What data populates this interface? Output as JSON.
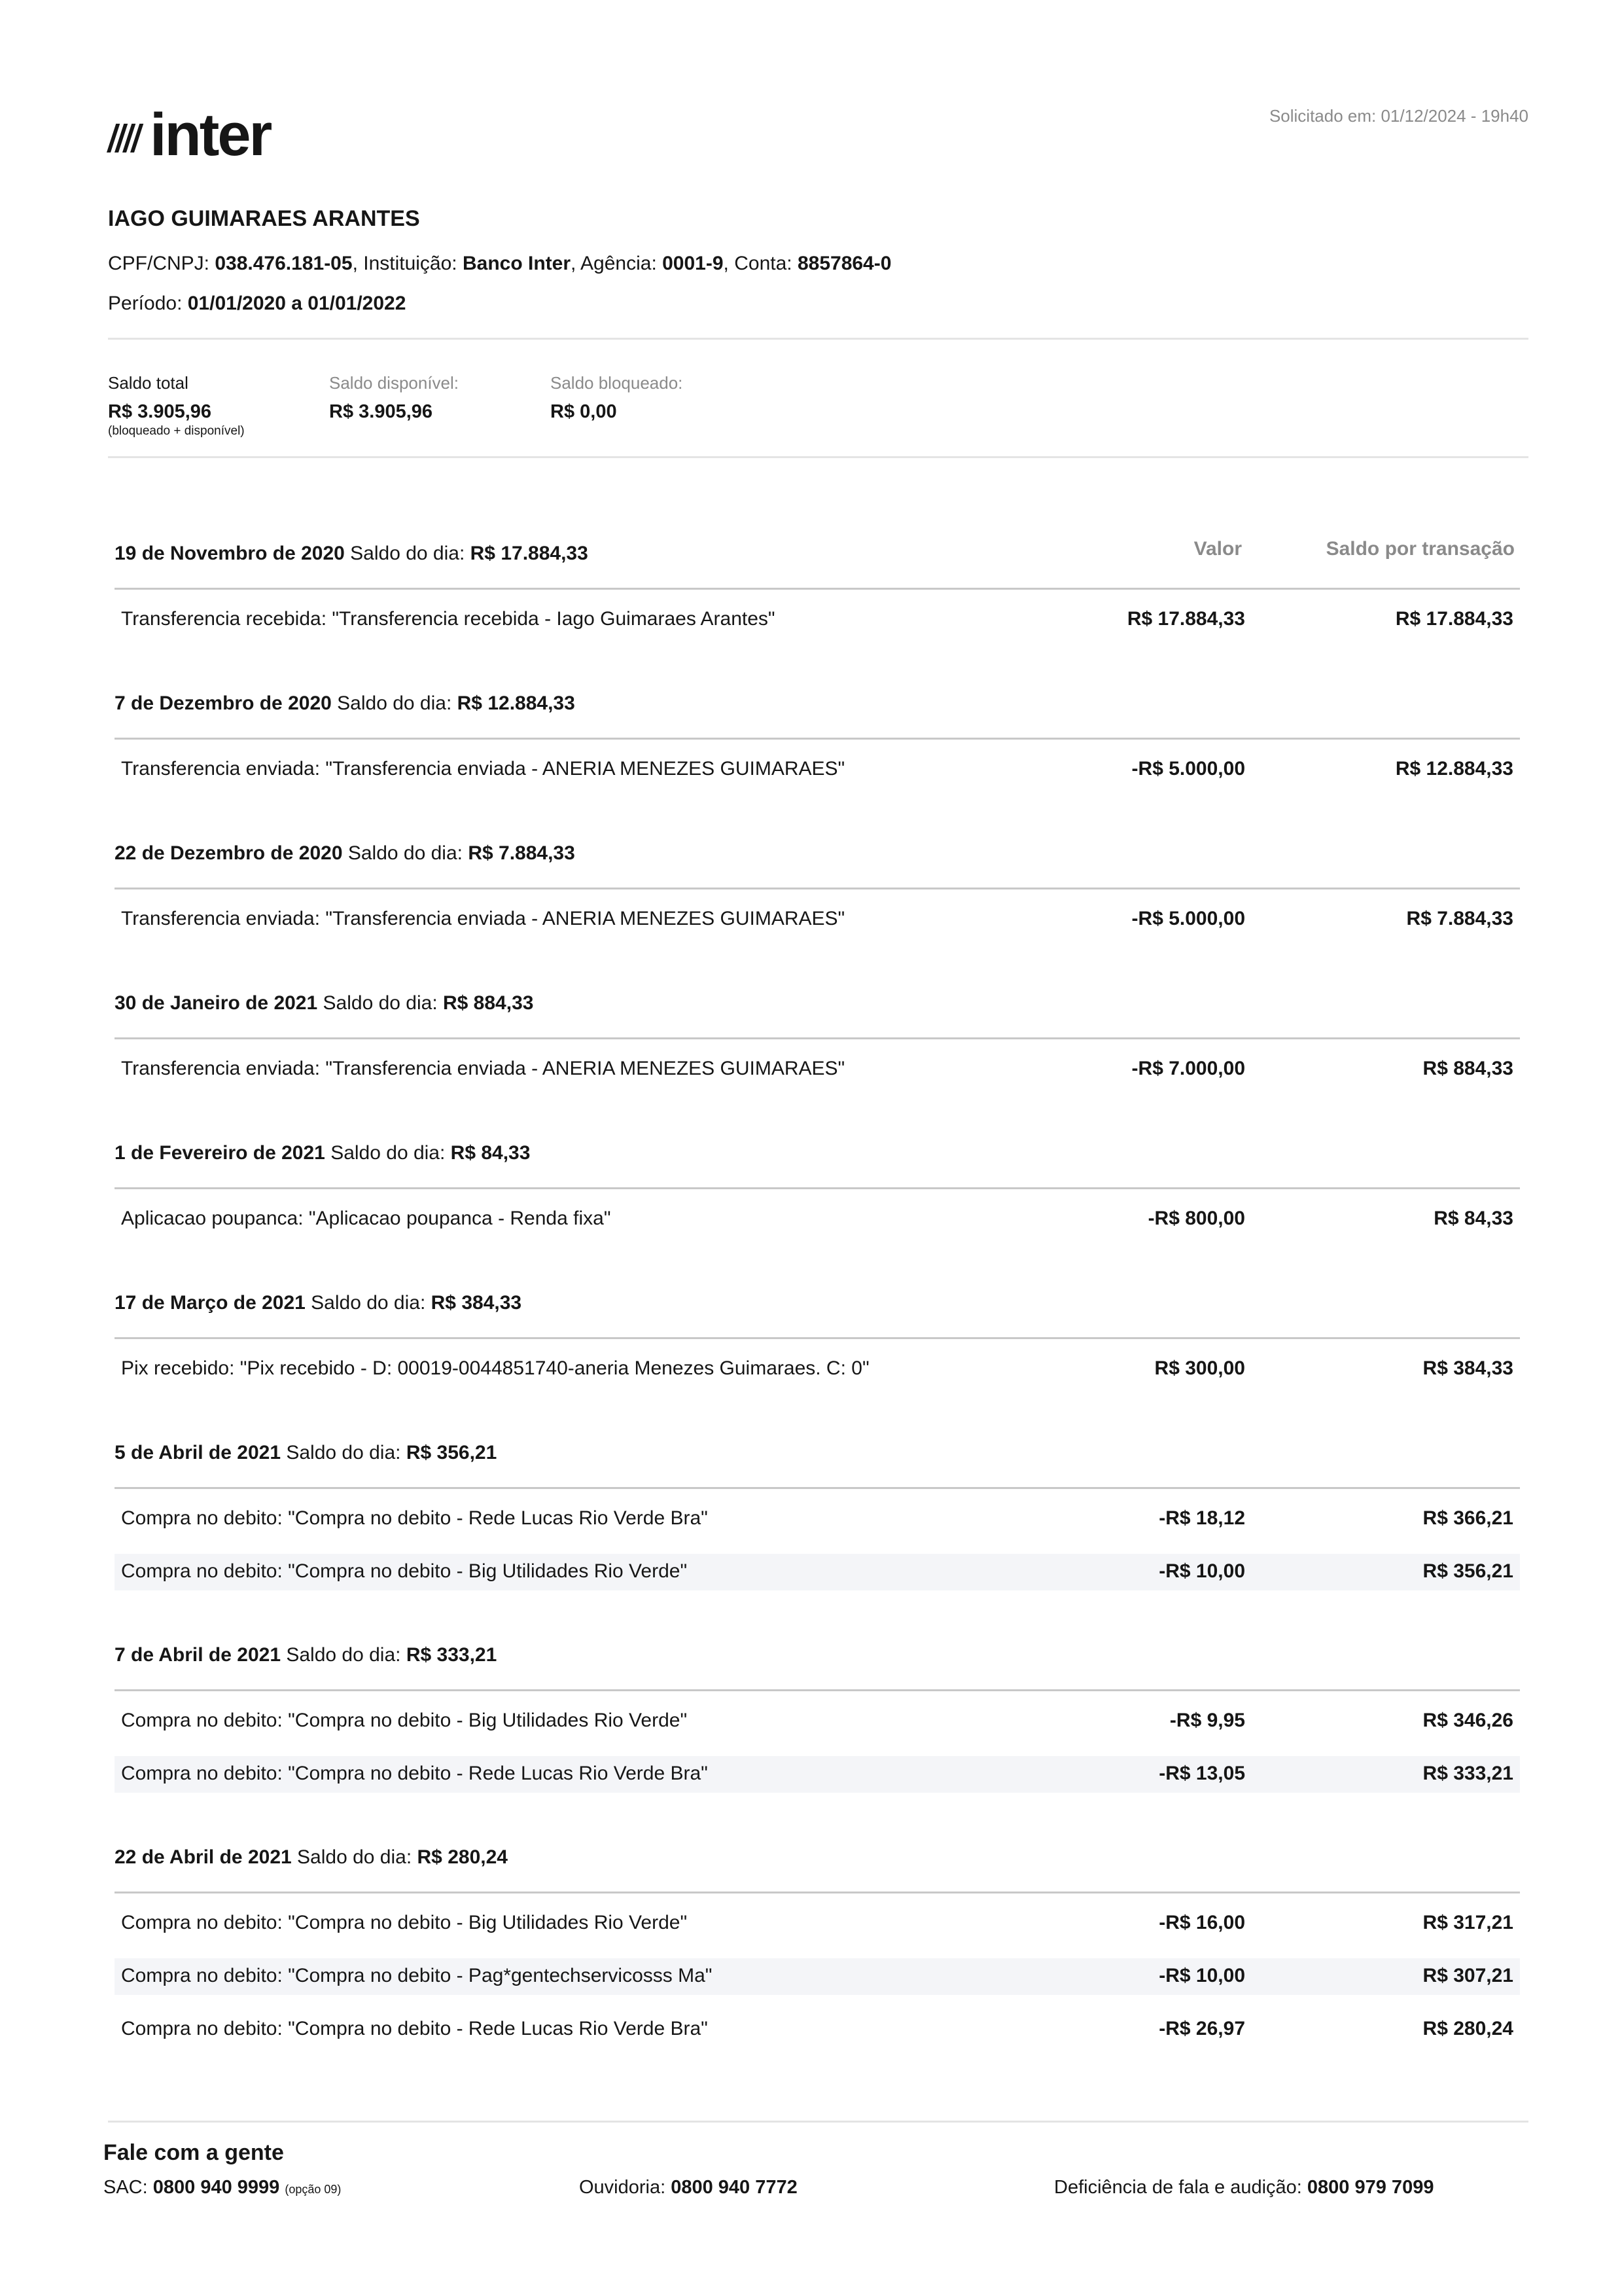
{
  "header": {
    "brand": "inter",
    "requested_label": "Solicitado em: 01/12/2024 - 19h40"
  },
  "account": {
    "holder_name": "IAGO GUIMARAES ARANTES",
    "cpf_label": "CPF/CNPJ: ",
    "cpf": "038.476.181-05",
    "institution_label": ", Instituição: ",
    "institution": "Banco Inter",
    "agency_label": ", Agência: ",
    "agency": "0001-9",
    "account_label": ", Conta: ",
    "account_number": "8857864-0",
    "period_label": "Período: ",
    "period": "01/01/2020 a 01/01/2022"
  },
  "balances": {
    "total_label": "Saldo total",
    "total": "R$ 3.905,96",
    "total_note": "(bloqueado + disponível)",
    "available_label": "Saldo disponível:",
    "available": "R$ 3.905,96",
    "blocked_label": "Saldo bloqueado:",
    "blocked": "R$ 0,00"
  },
  "table": {
    "value_header": "Valor",
    "balance_header": "Saldo por transação",
    "day_balance_label": " Saldo do dia: "
  },
  "days": [
    {
      "date": "19 de Novembro de 2020",
      "day_balance": "R$ 17.884,33",
      "transactions": [
        {
          "description": "Transferencia recebida: \"Transferencia recebida - Iago Guimaraes Arantes\"",
          "value": "R$ 17.884,33",
          "balance": "R$ 17.884,33"
        }
      ]
    },
    {
      "date": "7 de Dezembro de 2020",
      "day_balance": "R$ 12.884,33",
      "transactions": [
        {
          "description": "Transferencia enviada: \"Transferencia enviada - ANERIA MENEZES GUIMARAES\"",
          "value": "-R$ 5.000,00",
          "balance": "R$ 12.884,33"
        }
      ]
    },
    {
      "date": "22 de Dezembro de 2020",
      "day_balance": "R$ 7.884,33",
      "transactions": [
        {
          "description": "Transferencia enviada: \"Transferencia enviada - ANERIA MENEZES GUIMARAES\"",
          "value": "-R$ 5.000,00",
          "balance": "R$ 7.884,33"
        }
      ]
    },
    {
      "date": "30 de Janeiro de 2021",
      "day_balance": "R$ 884,33",
      "transactions": [
        {
          "description": "Transferencia enviada: \"Transferencia enviada - ANERIA MENEZES GUIMARAES\"",
          "value": "-R$ 7.000,00",
          "balance": "R$ 884,33"
        }
      ]
    },
    {
      "date": "1 de Fevereiro de 2021",
      "day_balance": "R$ 84,33",
      "transactions": [
        {
          "description": "Aplicacao poupanca: \"Aplicacao poupanca - Renda fixa\"",
          "value": "-R$ 800,00",
          "balance": "R$ 84,33"
        }
      ]
    },
    {
      "date": "17 de Março de 2021",
      "day_balance": "R$ 384,33",
      "transactions": [
        {
          "description": "Pix recebido: \"Pix recebido - D: 00019-0044851740-aneria Menezes Guimaraes. C: 0\"",
          "value": "R$ 300,00",
          "balance": "R$ 384,33"
        }
      ]
    },
    {
      "date": "5 de Abril de 2021",
      "day_balance": "R$ 356,21",
      "transactions": [
        {
          "description": "Compra no debito: \"Compra no debito - Rede Lucas Rio Verde Bra\"",
          "value": "-R$ 18,12",
          "balance": "R$ 366,21"
        },
        {
          "description": "Compra no debito: \"Compra no debito - Big Utilidades Rio Verde\"",
          "value": "-R$ 10,00",
          "balance": "R$ 356,21"
        }
      ]
    },
    {
      "date": "7 de Abril de 2021",
      "day_balance": "R$ 333,21",
      "transactions": [
        {
          "description": "Compra no debito: \"Compra no debito - Big Utilidades Rio Verde\"",
          "value": "-R$ 9,95",
          "balance": "R$ 346,26"
        },
        {
          "description": "Compra no debito: \"Compra no debito - Rede Lucas Rio Verde Bra\"",
          "value": "-R$ 13,05",
          "balance": "R$ 333,21"
        }
      ]
    },
    {
      "date": "22 de Abril de 2021",
      "day_balance": "R$ 280,24",
      "transactions": [
        {
          "description": "Compra no debito: \"Compra no debito - Big Utilidades Rio Verde\"",
          "value": "-R$ 16,00",
          "balance": "R$ 317,21"
        },
        {
          "description": "Compra no debito: \"Compra no debito - Pag*gentechservicosss Ma\"",
          "value": "-R$ 10,00",
          "balance": "R$ 307,21"
        },
        {
          "description": "Compra no debito: \"Compra no debito - Rede Lucas Rio Verde Bra\"",
          "value": "-R$ 26,97",
          "balance": "R$ 280,24"
        }
      ]
    }
  ],
  "footer": {
    "title": "Fale com a gente",
    "sac_label": "SAC: ",
    "sac_number": "0800 940 9999",
    "sac_note": "(opção 09)",
    "ouvidoria_label": "Ouvidoria: ",
    "ouvidoria_number": "0800 940 7772",
    "deficiencia_label": "Deficiência de fala e audição: ",
    "deficiencia_number": "0800 979 7099"
  }
}
